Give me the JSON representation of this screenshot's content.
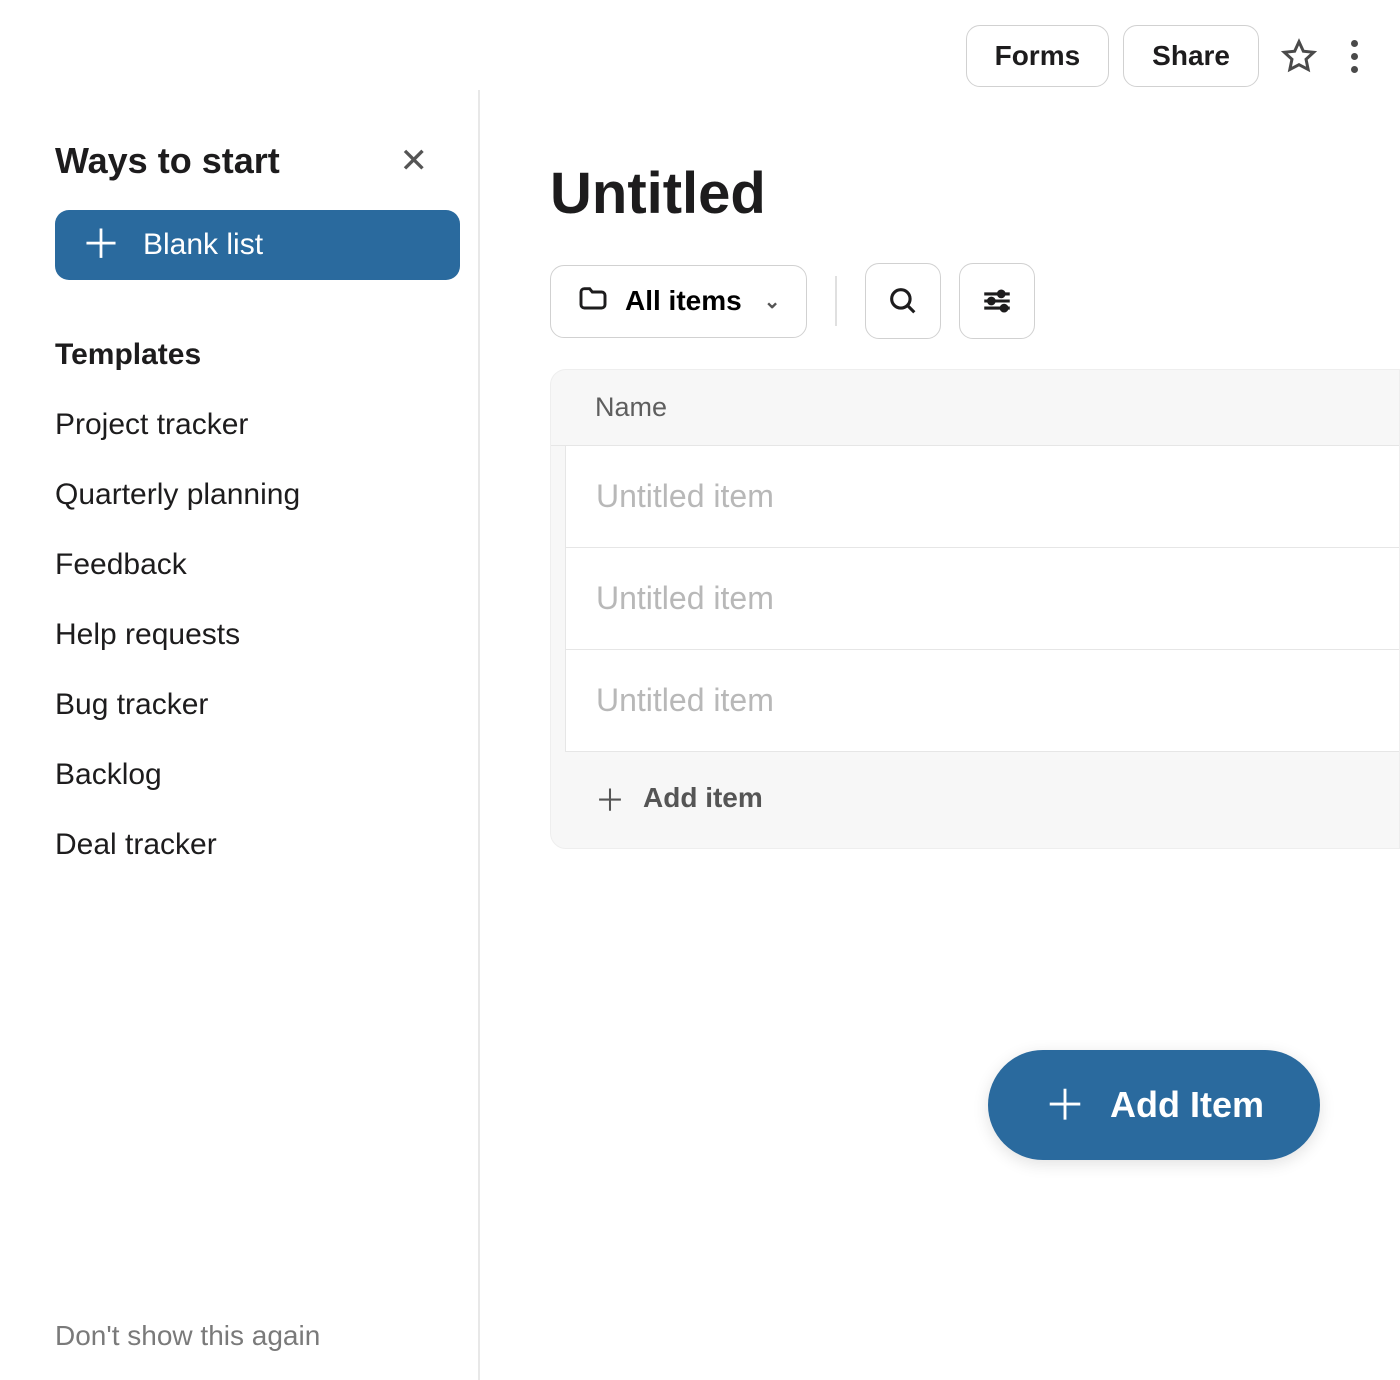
{
  "topbar": {
    "forms_label": "Forms",
    "share_label": "Share"
  },
  "sidebar": {
    "title": "Ways to start",
    "blank_list_label": "Blank list",
    "templates_heading": "Templates",
    "templates": [
      "Project tracker",
      "Quarterly planning",
      "Feedback",
      "Help requests",
      "Bug tracker",
      "Backlog",
      "Deal tracker"
    ],
    "dont_show_label": "Don't show this again"
  },
  "main": {
    "title": "Untitled",
    "view_selector_label": "All items",
    "column_header": "Name",
    "item_placeholder": "Untitled item",
    "items": [
      {
        "text": ""
      },
      {
        "text": ""
      },
      {
        "text": ""
      }
    ],
    "add_item_row_label": "Add item",
    "fab_label": "Add Item"
  },
  "colors": {
    "accent": "#2a6a9e"
  }
}
